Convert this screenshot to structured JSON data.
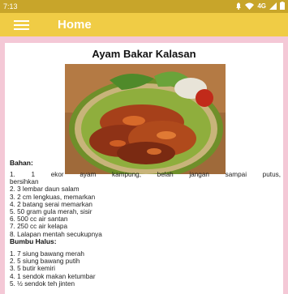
{
  "status_bar": {
    "time": "7:13",
    "network": "4G",
    "icons": [
      "notification-icon",
      "wifi-icon",
      "signal-icon",
      "battery-icon"
    ]
  },
  "app_bar": {
    "title": "Home",
    "menu_icon": "hamburger-menu-icon"
  },
  "recipe": {
    "title": "Ayam Bakar Kalasan",
    "bahan_heading": "Bahan:",
    "bahan": [
      "1. 1 ekor ayam kampung, belah jangan sampai putus,",
      "bersihkan",
      "2. 3 lembar daun salam",
      "3. 2 cm lengkuas, memarkan",
      "4. 2 batang serai memarkan",
      "5. 50 gram gula merah, sisir",
      "6. 500 cc air santan",
      "7. 250 cc air kelapa",
      "8. Lalapan mentah secukupnya"
    ],
    "bumbu_heading": "Bumbu Halus:",
    "bumbu": [
      "1. 7 siung bawang merah",
      "2. 5 siung bawang putih",
      "3. 5 butir kemiri",
      "4. 1 sendok makan ketumbar",
      "5. ½ sendok teh jinten"
    ]
  },
  "colors": {
    "status_bar": "#c8a52a",
    "app_bar": "#f0cc45",
    "background": "#f4c8d6",
    "card": "#ffffff"
  }
}
